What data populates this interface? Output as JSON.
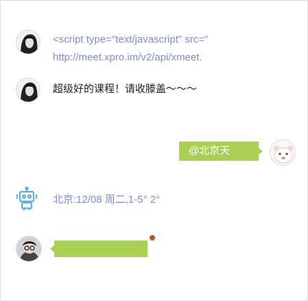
{
  "messages": [
    {
      "line1": "<script type=\"text/javascript\" src=\"",
      "line2": "http://meet.xpro.im/v2/api/xmeet."
    },
    {
      "text": "超级好的课程！请收滕盖～～～"
    },
    {
      "text": "@北京天气？"
    },
    {
      "text": "北京:12/08 周二,1-5°  2°"
    },
    {
      "text": ""
    }
  ],
  "colors": {
    "accent": "#a9cf55",
    "link": "#7a8fd9",
    "robot": "#5aaee8",
    "unread": "#c0502e"
  },
  "icons": {
    "robot": "robot-icon"
  }
}
